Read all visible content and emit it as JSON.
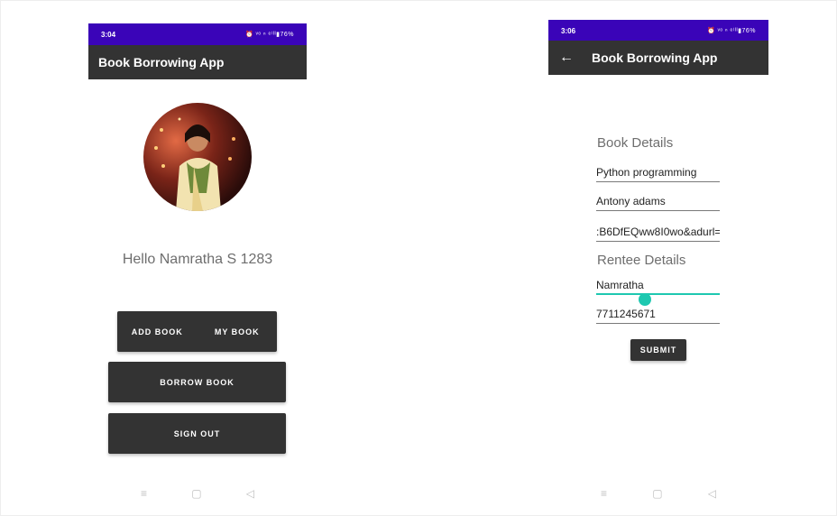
{
  "left_screen": {
    "status": {
      "time": "3:04",
      "icons": "⏰ ᵛᵒ ⁿ ᵉ⁽ᴵᴵ▮76%"
    },
    "app_title": "Book Borrowing App",
    "greeting": "Hello Namratha S 1283",
    "buttons": {
      "add_book": "ADD BOOK",
      "my_book": "MY BOOK",
      "borrow_book": "BORROW BOOK",
      "sign_out": "SIGN OUT"
    },
    "nav": {
      "menu": "≡",
      "home": "▢",
      "back": "◁"
    }
  },
  "right_screen": {
    "status": {
      "time": "3:06",
      "icons": "⏰ ᵛᵒ ⁿ ᵉ⁽ᴵᴵ▮76%"
    },
    "app_title": "Book Borrowing App",
    "book_details_heading": "Book Details",
    "book_title_value": "Python programming",
    "author_value": "Antony adams",
    "url_value": ":B6DfEQww8I0wo&adurl=",
    "rentee_details_heading": "Rentee Details",
    "rentee_name_value": "Namratha",
    "phone_value": "7711245671",
    "submit_label": "SUBMIT",
    "nav": {
      "menu": "≡",
      "home": "▢",
      "back": "◁"
    }
  },
  "colors": {
    "status_bar": "#3a04b8",
    "app_bar": "#333333",
    "accent": "#1ec8b0"
  },
  "icons": [
    "alarm-icon",
    "signal-icon",
    "battery-icon",
    "back-arrow-icon",
    "profile-photo",
    "menu-icon",
    "home-icon",
    "back-icon"
  ]
}
